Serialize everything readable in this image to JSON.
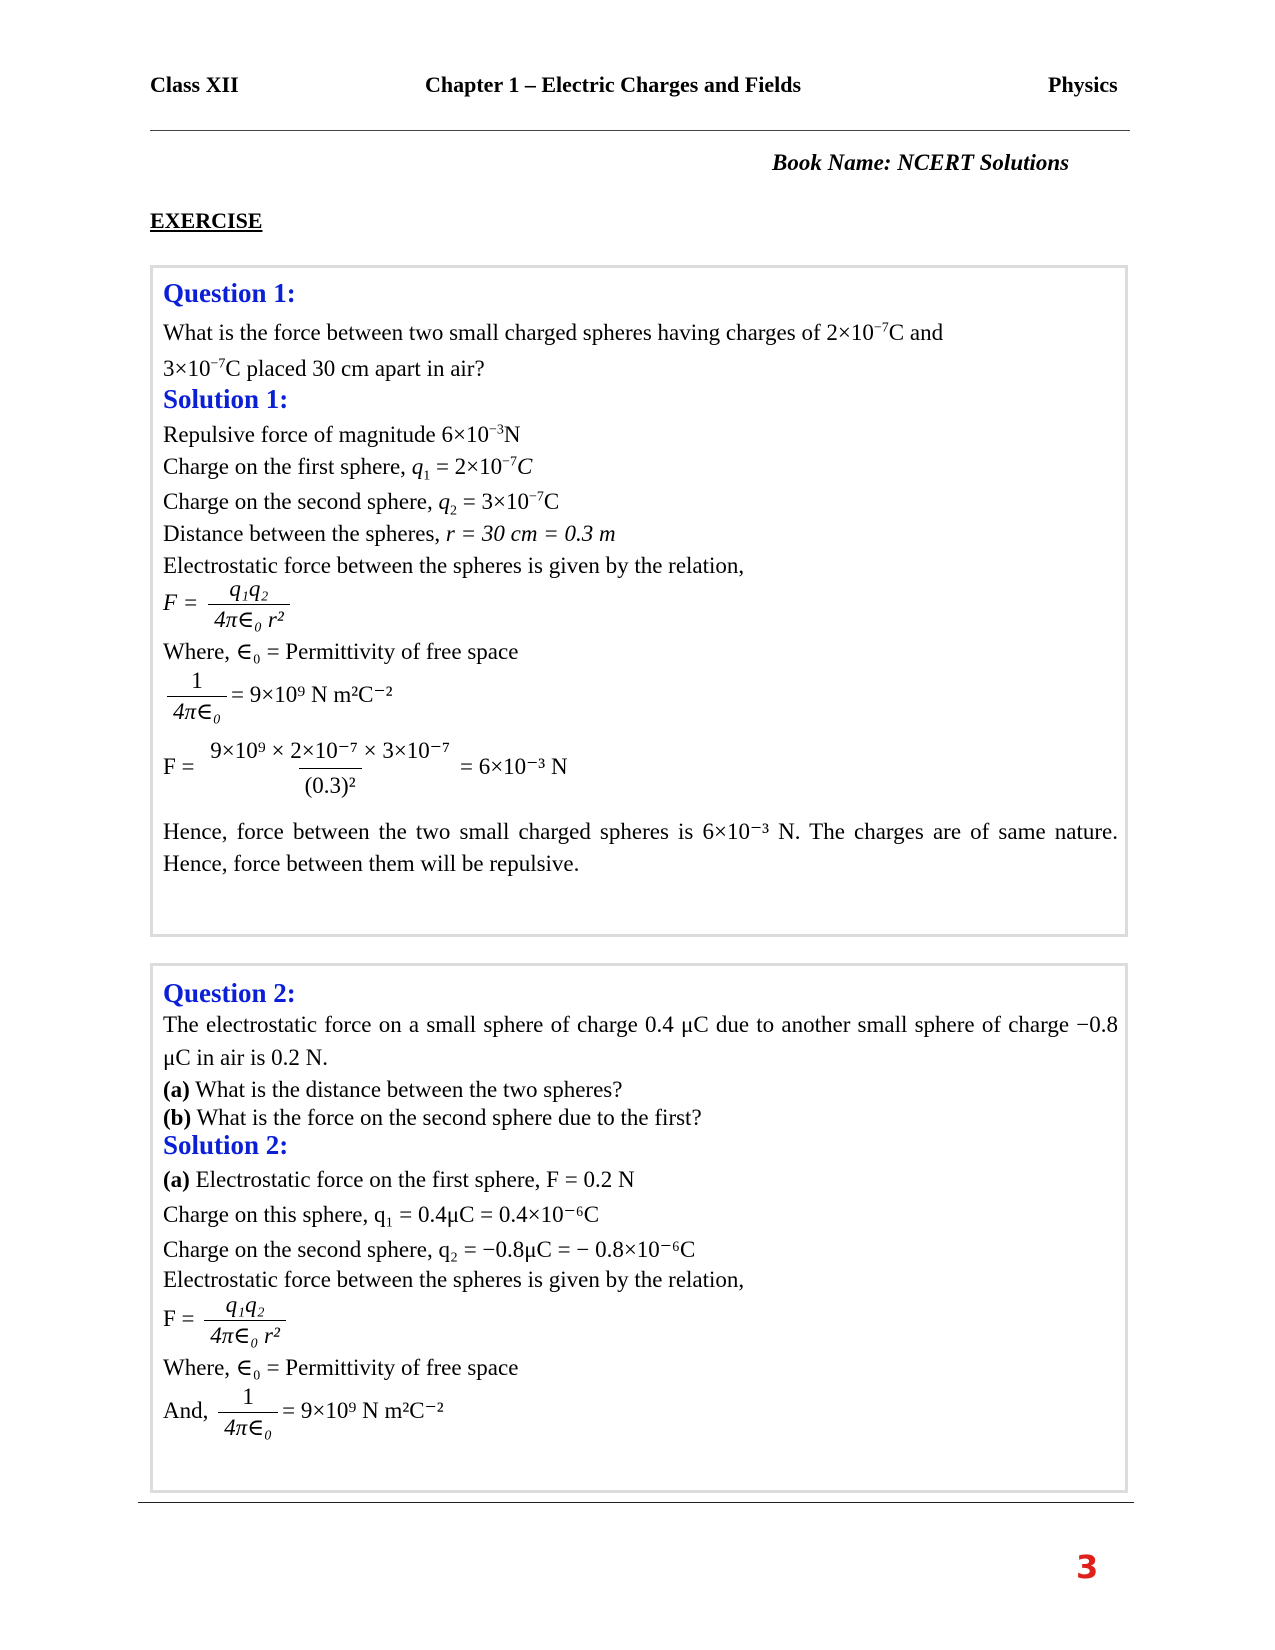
{
  "header": {
    "left": "Class XII",
    "center": "Chapter 1 – Electric Charges and Fields",
    "right": "Physics"
  },
  "book_name": "Book Name: NCERT Solutions",
  "section_title": "EXERCISE",
  "accent_color": "#0a1fd6",
  "page_number": "3",
  "q1": {
    "heading": "Question 1:",
    "text_a": "What is the force between two small charged spheres having charges of",
    "charge_a": "2×10",
    "exp_a": "−7",
    "unit_a": "C",
    "text_and": "and",
    "charge_b": "3×10",
    "exp_b": "−7",
    "unit_b": "C",
    "text_b": "placed 30 cm apart in air?"
  },
  "s1": {
    "heading": "Solution 1:",
    "l1_text": "Repulsive force of magnitude",
    "l1_val": "6×10",
    "l1_exp": "−3",
    "l1_unit": "N",
    "l2_text": "Charge on the first sphere,",
    "l2_var": "q",
    "l2_sub": "1",
    "l2_val": "= 2×10",
    "l2_exp": "−7",
    "l2_unit": "C",
    "l3_text": "Charge on the second sphere,",
    "l3_var": "q",
    "l3_sub": "2",
    "l3_val": "= 3×10",
    "l3_exp": "−7",
    "l3_unit": "C",
    "l4_text": "Distance between the spheres,",
    "l4_val": "r = 30 cm = 0.3 m",
    "l5_text": "Electrostatic force between the spheres is given by the relation,",
    "f1_lhs": "F =",
    "f1_num": "q₁q₂",
    "f1_den": "4π∈₀ r²",
    "where_text": "Where, ∈₀ = Permittivity of free space",
    "k_num": "1",
    "k_den": "4π∈₀",
    "k_rhs": "= 9×10⁹ N m²C⁻²",
    "calc_lhs": "F =",
    "calc_num": "9×10⁹ × 2×10⁻⁷ × 3×10⁻⁷",
    "calc_den": "(0.3)²",
    "calc_rhs": "= 6×10⁻³ N",
    "conclusion": "Hence, force between the two small charged spheres is 6×10⁻³ N. The charges are of same nature. Hence, force between them will be repulsive."
  },
  "q2": {
    "heading": "Question 2:",
    "text": "The electrostatic force on a small sphere of charge 0.4 μC due to another small sphere of charge −0.8 μC in air is 0.2 N.",
    "part_a_label": "(a)",
    "part_a": "What is the distance between the two spheres?",
    "part_b_label": "(b)",
    "part_b": "What is the force on the second sphere due to the first?"
  },
  "s2": {
    "heading": "Solution 2:",
    "l1_label": "(a)",
    "l1_text": "Electrostatic force on the first sphere, F = 0.2 N",
    "l2_text": "Charge on this sphere,",
    "l2_val": "q₁ = 0.4μC = 0.4×10⁻⁶C",
    "l3_text": "Charge on the second sphere,",
    "l3_val": "q₂ = −0.8μC = − 0.8×10⁻⁶C",
    "l4_text": "Electrostatic force between the spheres is given by the relation,",
    "f_lhs": "F =",
    "f_num": "q₁q₂",
    "f_den": "4π∈₀ r²",
    "where_text": "Where, ∈₀ = Permittivity of free space",
    "and_text": "And,",
    "k_num": "1",
    "k_den": "4π∈₀",
    "k_rhs": "= 9×10⁹ N m²C⁻²"
  }
}
